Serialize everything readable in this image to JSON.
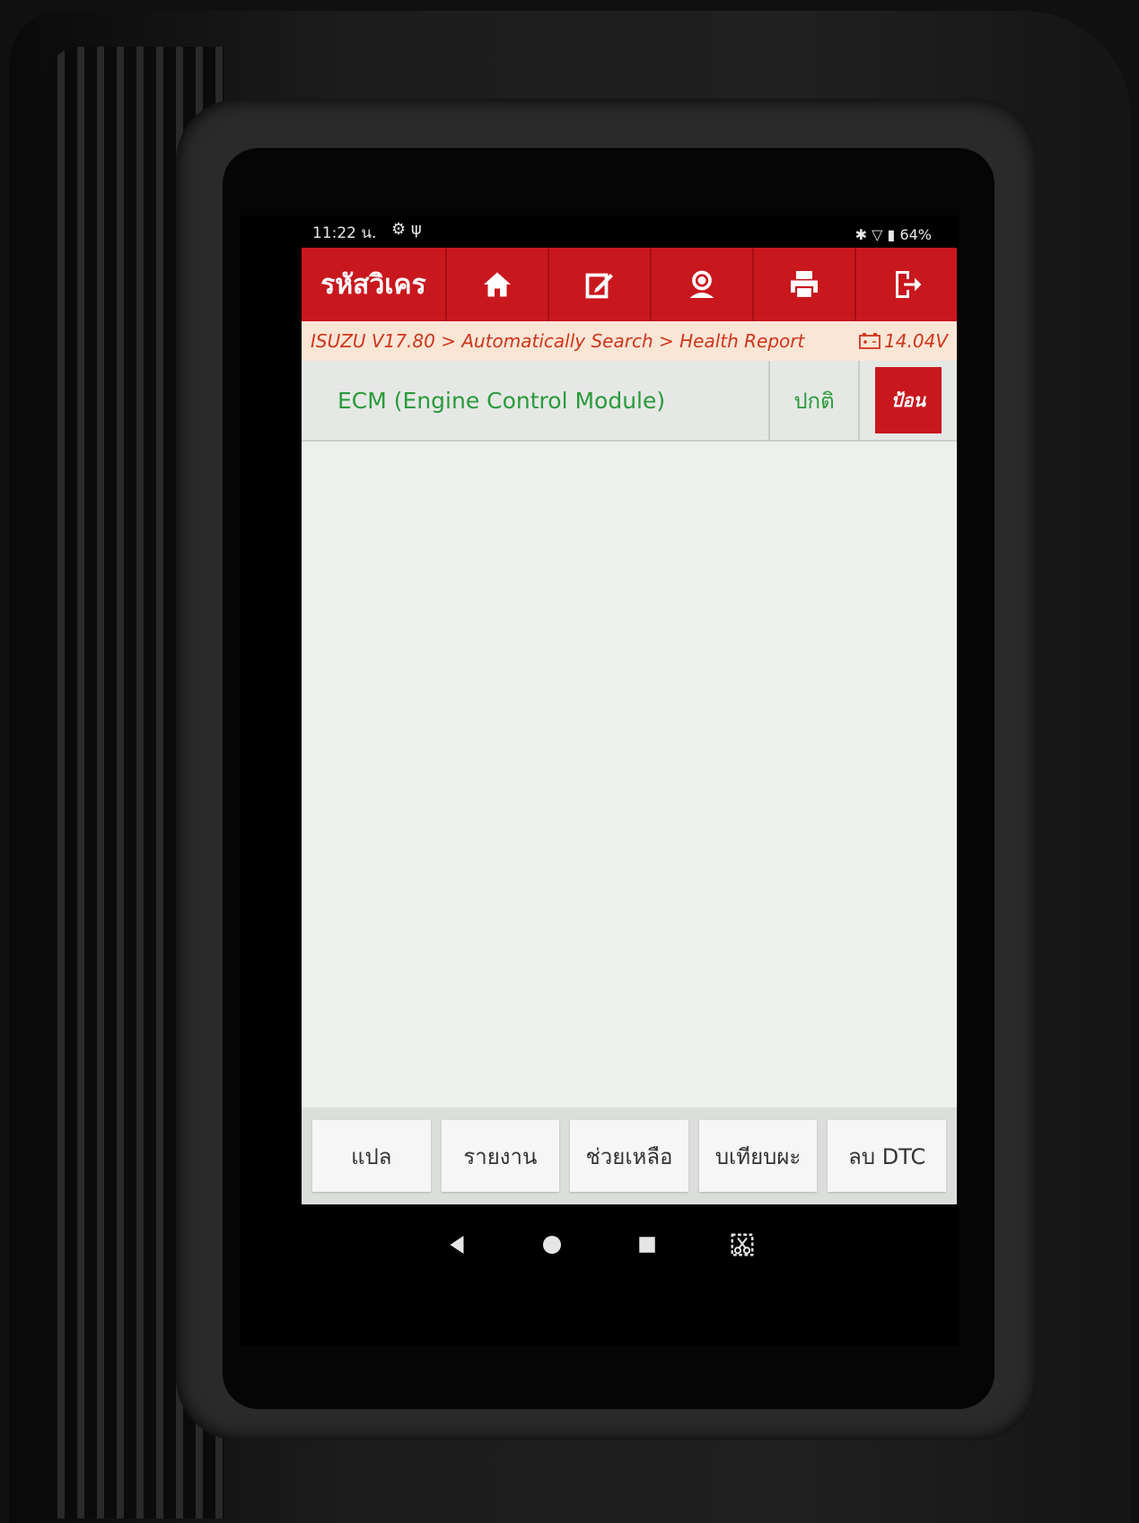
{
  "status_bar": {
    "time": "11:22 น.",
    "left_icons": [
      "gear-icon",
      "usb-icon"
    ],
    "right_icons": "✱ ▽ ▮",
    "battery": "64%"
  },
  "header": {
    "title": "รหัสวิเคร",
    "tools": [
      "home-icon",
      "edit-icon",
      "support-icon",
      "print-icon",
      "exit-icon"
    ],
    "color": "#c9171e"
  },
  "breadcrumb": {
    "path": "ISUZU V17.80 > Automatically Search > Health Report",
    "voltage": "14.04V"
  },
  "results": [
    {
      "system": "ECM (Engine Control Module)",
      "status": "ปกติ",
      "action": "ป้อน"
    }
  ],
  "footer": {
    "buttons": [
      "แปล",
      "รายงาน",
      "ช่วยเหลือ",
      "บเทียบผะ",
      "ลบ DTC"
    ]
  },
  "navigation": [
    "back-icon",
    "home-circle-icon",
    "recents-icon",
    "screenshot-icon"
  ]
}
